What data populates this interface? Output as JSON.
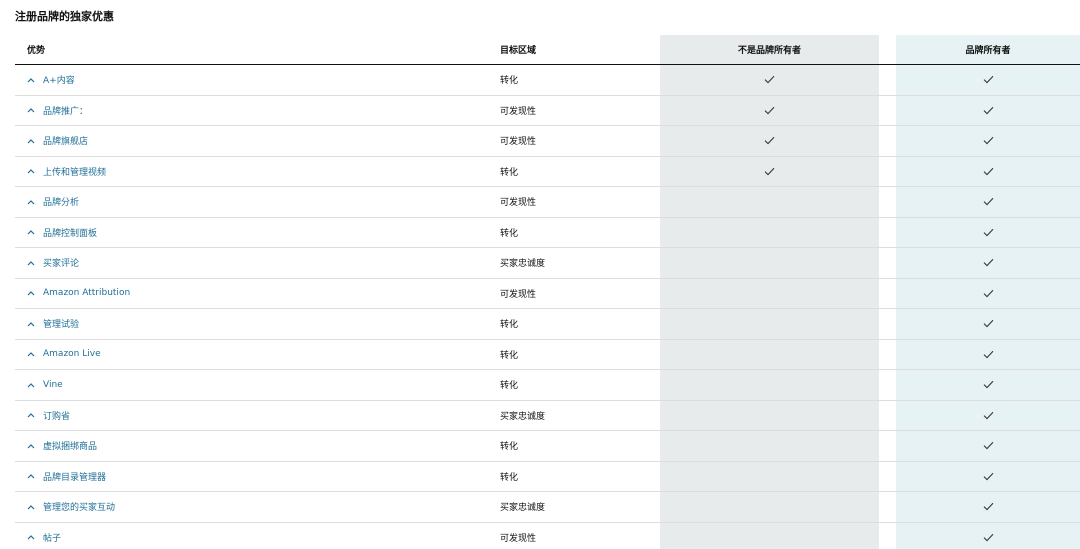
{
  "page_title": "注册品牌的独家优惠",
  "table": {
    "headers": {
      "benefit": "优势",
      "target_area": "目标区域",
      "non_owner": "不是品牌所有者",
      "owner": "品牌所有者"
    },
    "rows": [
      {
        "benefit": "A+内容",
        "target_area": "转化",
        "non_owner": true,
        "owner": true
      },
      {
        "benefit": "品牌推广：",
        "target_area": "可发现性",
        "non_owner": true,
        "owner": true
      },
      {
        "benefit": "品牌旗舰店",
        "target_area": "可发现性",
        "non_owner": true,
        "owner": true
      },
      {
        "benefit": "上传和管理视频",
        "target_area": "转化",
        "non_owner": true,
        "owner": true
      },
      {
        "benefit": "品牌分析",
        "target_area": "可发现性",
        "non_owner": false,
        "owner": true
      },
      {
        "benefit": "品牌控制面板",
        "target_area": "转化",
        "non_owner": false,
        "owner": true
      },
      {
        "benefit": "买家评论",
        "target_area": "买家忠诚度",
        "non_owner": false,
        "owner": true
      },
      {
        "benefit": "Amazon Attribution",
        "target_area": "可发现性",
        "non_owner": false,
        "owner": true
      },
      {
        "benefit": "管理试验",
        "target_area": "转化",
        "non_owner": false,
        "owner": true
      },
      {
        "benefit": "Amazon Live",
        "target_area": "转化",
        "non_owner": false,
        "owner": true
      },
      {
        "benefit": "Vine",
        "target_area": "转化",
        "non_owner": false,
        "owner": true
      },
      {
        "benefit": "订购省",
        "target_area": "买家忠诚度",
        "non_owner": false,
        "owner": true
      },
      {
        "benefit": "虚拟捆绑商品",
        "target_area": "转化",
        "non_owner": false,
        "owner": true
      },
      {
        "benefit": "品牌目录管理器",
        "target_area": "转化",
        "non_owner": false,
        "owner": true
      },
      {
        "benefit": "管理您的买家互动",
        "target_area": "买家忠诚度",
        "non_owner": false,
        "owner": true
      },
      {
        "benefit": "帖子",
        "target_area": "可发现性",
        "non_owner": false,
        "owner": true
      }
    ]
  },
  "icons": {
    "expand": "chevron-up-icon",
    "included": "checkmark-icon"
  },
  "colors": {
    "link": "#1f6f97",
    "non_owner_bg": "#e7ebeb",
    "owner_bg": "#e6f2f3"
  }
}
